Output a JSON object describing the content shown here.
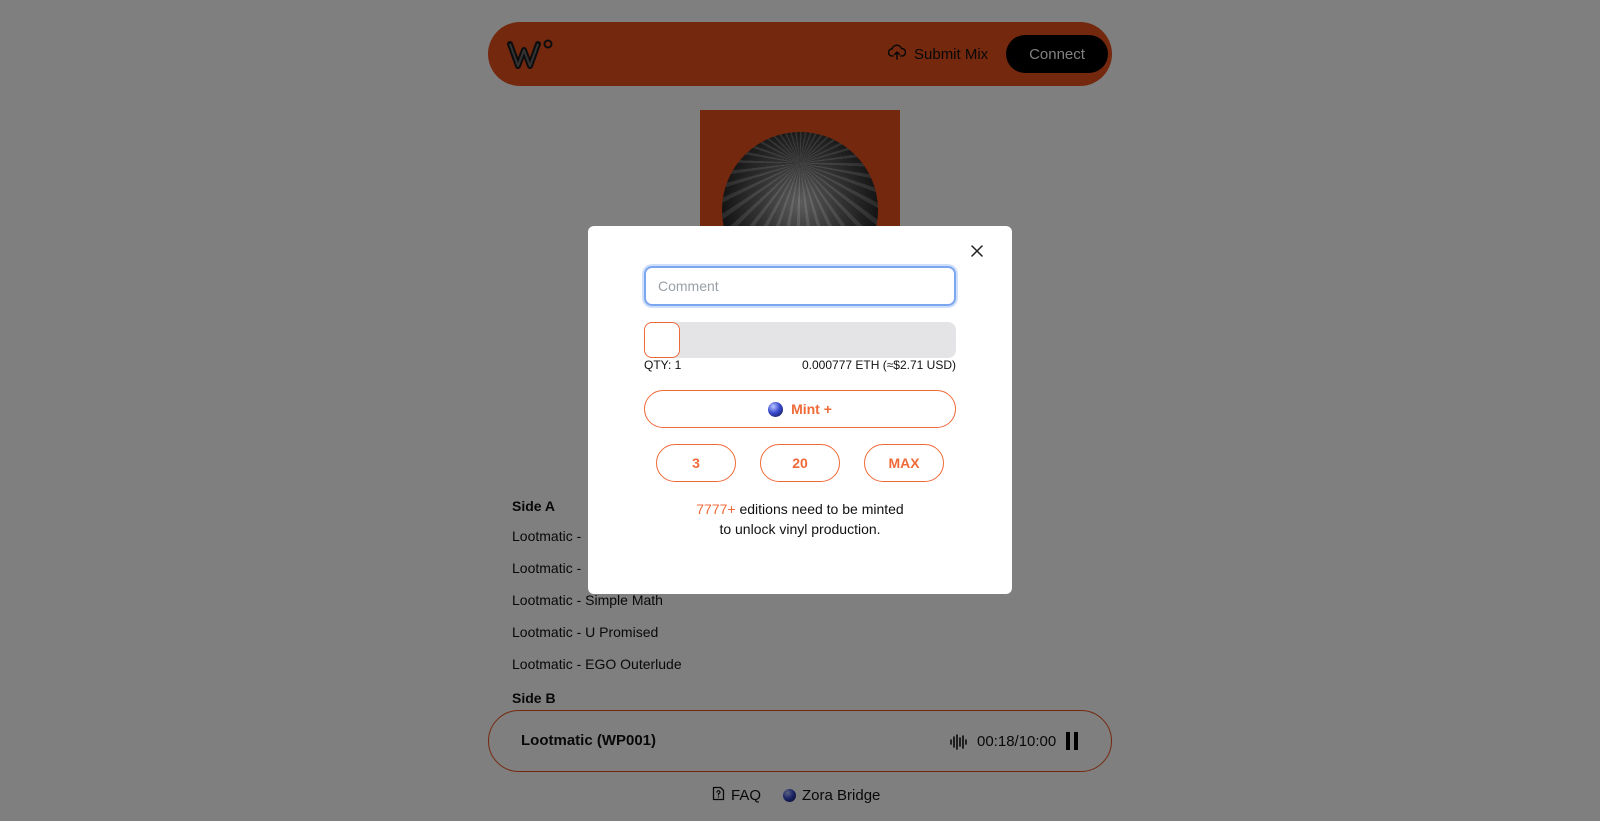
{
  "header": {
    "submit_label": "Submit Mix",
    "connect_label": "Connect",
    "brand_color": "#e8501c"
  },
  "tracklist": {
    "side_a": "Side A",
    "tracks": [
      "Lootmatic - ",
      "Lootmatic - ",
      "Lootmatic - Simple Math",
      "Lootmatic - U Promised",
      "Lootmatic - EGO Outerlude"
    ],
    "side_b": "Side B"
  },
  "player": {
    "title": "Lootmatic (WP001)",
    "time": "00:18/10:00",
    "icons": [
      "waveform-icon",
      "pause-icon"
    ]
  },
  "footer": {
    "faq": "FAQ",
    "bridge": "Zora Bridge"
  },
  "modal": {
    "comment_placeholder": "Comment",
    "comment_value": "",
    "qty_label": "QTY: 1",
    "quantity": 1,
    "price_label": "0.000777 ETH (≈$2.71 USD)",
    "mint_label": "Mint +",
    "presets": [
      "3",
      "20",
      "MAX"
    ],
    "note_accent": "7777+",
    "note_line1": " editions need to be minted",
    "note_line2": "to unlock vinyl production.",
    "accent_color": "#f06a38"
  }
}
